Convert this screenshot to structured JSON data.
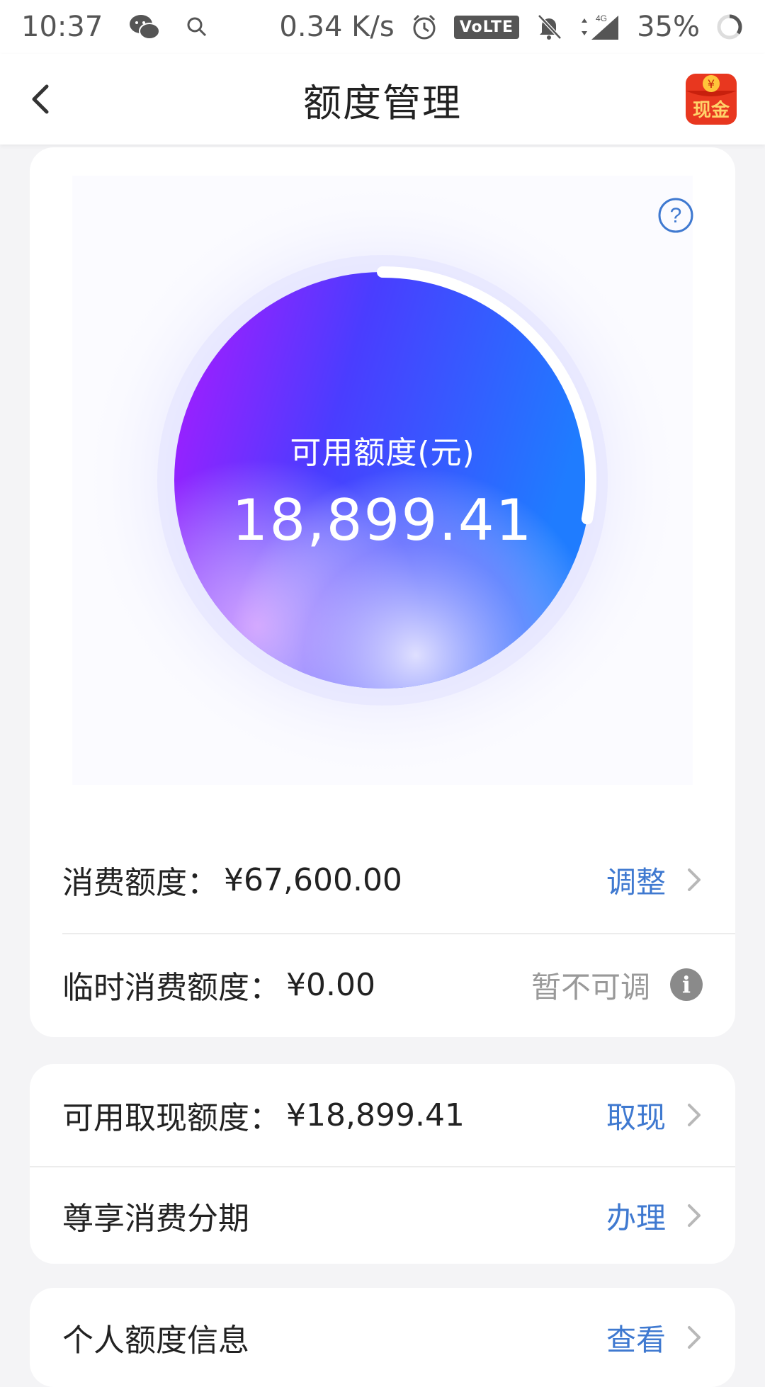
{
  "status_bar": {
    "time": "10:37",
    "network_speed": "0.34 K/s",
    "volte": "VoLTE",
    "signal_label": "4G",
    "battery": "35%"
  },
  "nav": {
    "title": "额度管理",
    "cash_badge": "现金"
  },
  "gauge": {
    "label": "可用额度(元)",
    "value": "18,899.41",
    "fraction_remaining": 0.2796,
    "colors": {
      "start": "#b018ff",
      "mid": "#4a3dff",
      "end": "#1f7cff"
    }
  },
  "consumption": {
    "label": "消费额度：",
    "amount": "¥67,600.00",
    "action": "调整"
  },
  "temporary": {
    "label": "临时消费额度：",
    "amount": "¥0.00",
    "action": "暂不可调"
  },
  "cash_withdrawal": {
    "label": "可用取现额度：",
    "amount": "¥18,899.41",
    "action": "取现"
  },
  "installment": {
    "label": "尊享消费分期",
    "action": "办理"
  },
  "personal_info": {
    "label": "个人额度信息",
    "action": "查看"
  },
  "accent_color": "#3f79d0"
}
